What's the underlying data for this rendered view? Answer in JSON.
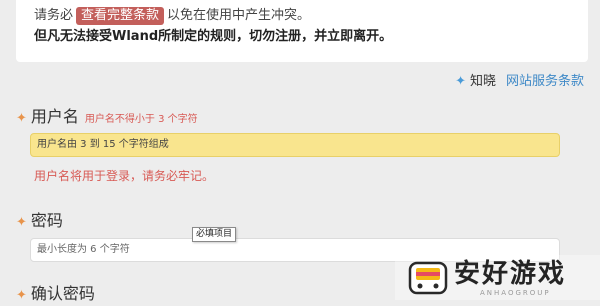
{
  "notice": {
    "prefix": "请务必",
    "terms_button": "查看完整条款",
    "suffix": "以免在使用中产生冲突。",
    "warning": "但凡无法接受Wland所制定的规则，切勿注册，并立即离开。"
  },
  "links": {
    "sparkle": "✦",
    "zhixiao": "知晓",
    "terms": "网站服务条款"
  },
  "username": {
    "label": "用户名",
    "inline_hint": "用户名不得小于 3 个字符",
    "placeholder": "用户名由 3 到 15 个字符组成",
    "note": "用户名将用于登录，请务必牢记。"
  },
  "password": {
    "label": "密码",
    "placeholder": "最小长度为 6 个字符",
    "tooltip": "必填项目"
  },
  "confirm_password": {
    "label": "确认密码"
  },
  "watermark": {
    "text": "安好游戏",
    "sub": "ANHAOGROUP"
  },
  "colors": {
    "accent_red": "#c35f5b",
    "hint_red": "#d85a55",
    "link_blue": "#3e89c7",
    "diamond_orange": "#e8944b",
    "input_yellow": "#f9e58e"
  }
}
